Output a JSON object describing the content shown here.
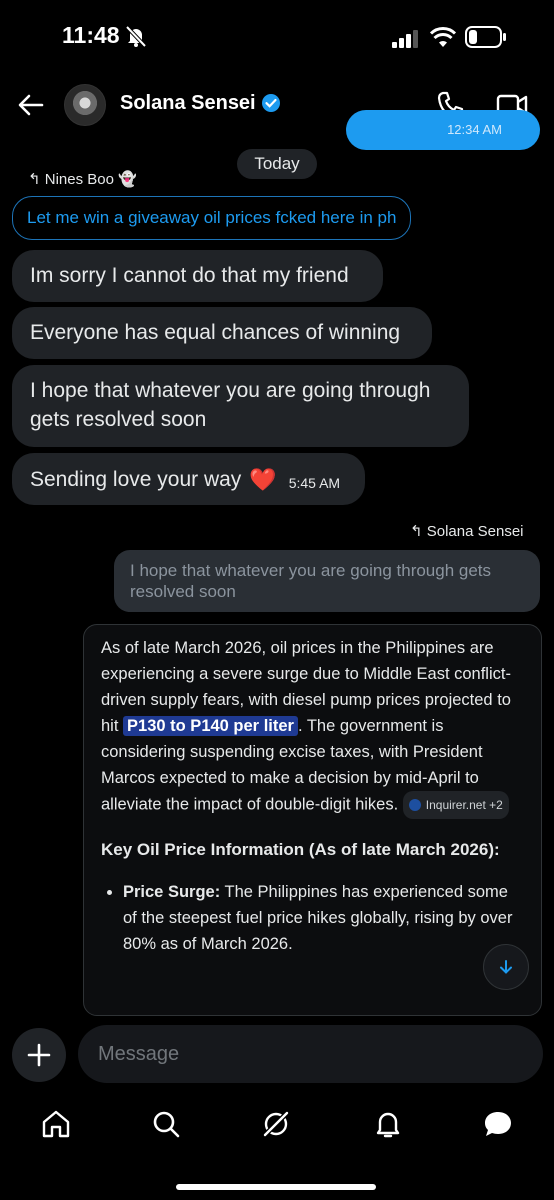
{
  "status_bar": {
    "time": "11:48"
  },
  "header": {
    "name": "Solana Sensei"
  },
  "top_bubble": {
    "timestamp": "12:34 AM"
  },
  "date_divider": "Today",
  "reply_from": {
    "icon": "reply-icon",
    "name": "Nines Boo",
    "emoji": "👻"
  },
  "quoted_message_left": "Let me win a giveaway oil prices fcked here in ph",
  "messages": [
    {
      "text": "Im sorry I cannot do that my friend"
    },
    {
      "text": "Everyone has equal chances of winning"
    },
    {
      "text": "I hope that whatever you are going through gets resolved soon"
    },
    {
      "text": "Sending love your way",
      "emoji": "❤️",
      "timestamp": "5:45 AM"
    }
  ],
  "reply_to": {
    "name": "Solana Sensei"
  },
  "quoted_message_right": "I hope that whatever you are going through gets resolved soon",
  "grok_card": {
    "para_before": "As of late March 2026, oil prices in the Philippines are experiencing a severe surge due to Middle East conflict-driven supply fears, with diesel pump prices projected to hit",
    "highlight": "P130 to P140 per liter",
    "para_after": ". The government is considering suspending excise taxes, with President Marcos expected to make a decision by mid-April to alleviate the impact of double-digit hikes.",
    "source_label": "Inquirer.net +2",
    "heading": "Key Oil Price Information (As of late March 2026):",
    "bullet_title": "Price Surge:",
    "bullet_text": " The Philippines has experienced some of the steepest fuel price hikes globally, rising by over 80% as of March 2026."
  },
  "composer": {
    "placeholder": "Message"
  },
  "nav": [
    "home-icon",
    "search-icon",
    "grok-icon",
    "notifications-icon",
    "messages-icon"
  ],
  "colors": {
    "accent": "#1d9bf0",
    "bubble": "#202327",
    "highlight": "#1f3a93",
    "heart": "#e0202a"
  }
}
